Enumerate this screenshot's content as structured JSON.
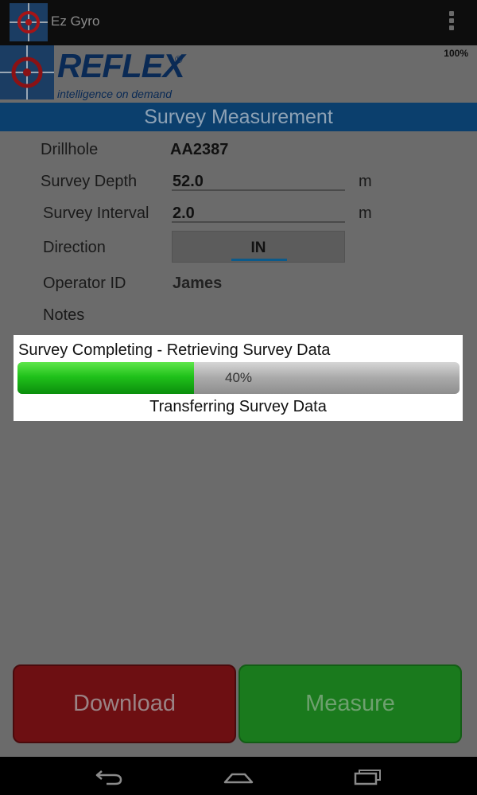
{
  "app": {
    "title": "Ez Gyro",
    "icon": "target-crosshair-icon",
    "menu_icon": "overflow-menu-icon"
  },
  "status": {
    "battery": "100%"
  },
  "brand": {
    "name": "REFLEX",
    "registered": "®",
    "tagline": "intelligence on demand"
  },
  "page": {
    "title": "Survey Measurement"
  },
  "form": {
    "drillhole": {
      "label": "Drillhole",
      "value": "AA2387"
    },
    "survey_depth": {
      "label": "Survey Depth",
      "value": "52.0",
      "unit": "m"
    },
    "survey_interval": {
      "label": "Survey Interval",
      "value": "2.0",
      "unit": "m"
    },
    "direction": {
      "label": "Direction",
      "value": "IN"
    },
    "operator": {
      "label": "Operator ID",
      "value": "James"
    },
    "notes": {
      "label": "Notes",
      "value": ""
    }
  },
  "dialog": {
    "title": "Survey Completing - Retrieving Survey Data",
    "progress_percent": 40,
    "progress_label": "40%",
    "message": "Transferring Survey Data"
  },
  "buttons": {
    "download": "Download",
    "measure": "Measure"
  },
  "navbar": {
    "back": "back-icon",
    "home": "home-icon",
    "recents": "recent-apps-icon"
  },
  "colors": {
    "brand_blue": "#0b3f6d",
    "download_red": "#6d0f12",
    "measure_green": "#1a7a1d",
    "progress_green": "#20c21b"
  }
}
